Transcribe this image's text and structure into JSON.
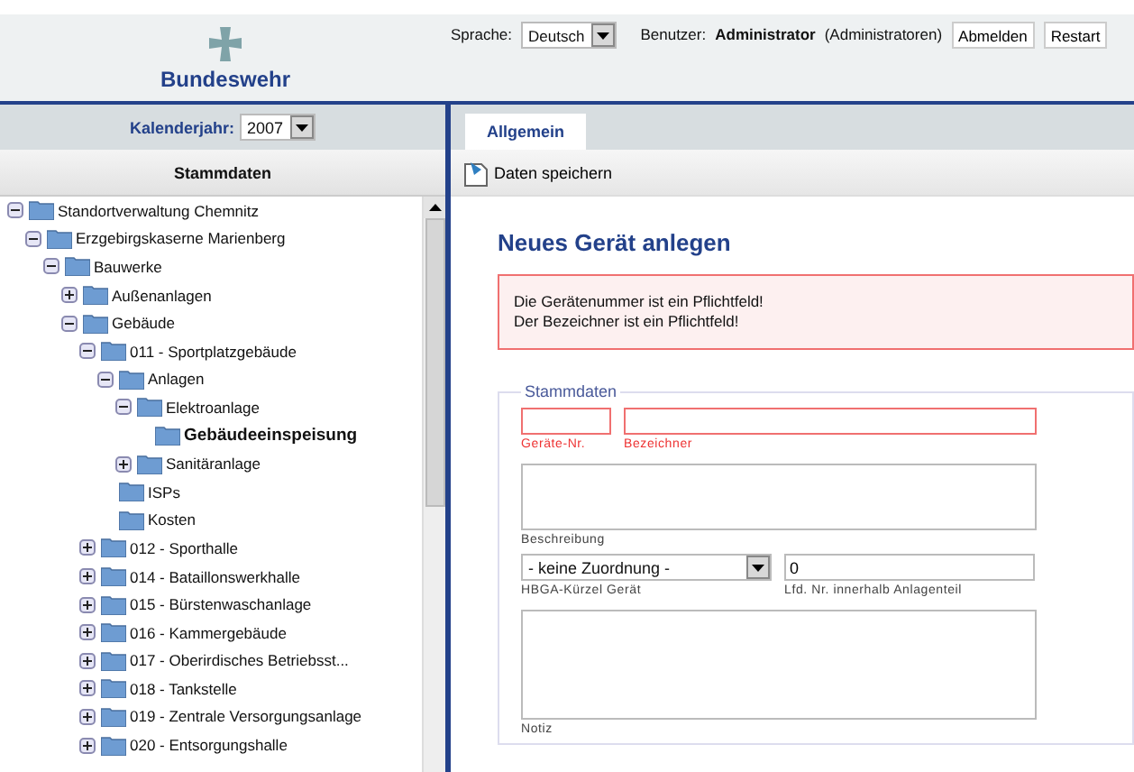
{
  "header": {
    "logo_text": "Bundeswehr",
    "language_label": "Sprache:",
    "language_value": "Deutsch",
    "user_label": "Benutzer:",
    "user_name": "Administrator",
    "user_role": "(Administratoren)",
    "buttons": [
      "Abmelden",
      "Restart"
    ]
  },
  "sidebar": {
    "year_label": "Kalenderjahr:",
    "year_value": "2007",
    "heading": "Stammdaten",
    "tree": [
      {
        "label": "Standortverwaltung Chemnitz",
        "expanded": true,
        "selected": false,
        "children": [
          {
            "label": "Erzgebirgskaserne Marienberg",
            "expanded": true,
            "selected": false,
            "children": [
              {
                "label": "Bauwerke",
                "expanded": true,
                "selected": false,
                "children": [
                  {
                    "label": "Außenanlagen",
                    "expanded": false,
                    "selected": false
                  },
                  {
                    "label": "Gebäude",
                    "expanded": true,
                    "selected": false,
                    "children": [
                      {
                        "label": "011 - Sportplatzgebäude",
                        "expanded": true,
                        "selected": false,
                        "children": [
                          {
                            "label": "Anlagen",
                            "expanded": true,
                            "selected": false,
                            "children": [
                              {
                                "label": "Elektroanlage",
                                "expanded": true,
                                "selected": false,
                                "children": [
                                  {
                                    "label": "Gebäudeeinspeisung",
                                    "selected": true
                                  }
                                ]
                              },
                              {
                                "label": "Sanitäranlage",
                                "expanded": false,
                                "selected": false
                              }
                            ]
                          },
                          {
                            "label": "ISPs",
                            "selected": false
                          },
                          {
                            "label": "Kosten",
                            "selected": false
                          }
                        ]
                      },
                      {
                        "label": "012 - Sporthalle",
                        "expanded": false,
                        "selected": false
                      },
                      {
                        "label": "014 - Bataillonswerkhalle",
                        "expanded": false,
                        "selected": false
                      },
                      {
                        "label": "015 - Bürstenwaschanlage",
                        "expanded": false,
                        "selected": false
                      },
                      {
                        "label": "016 - Kammergebäude",
                        "expanded": false,
                        "selected": false
                      },
                      {
                        "label": "017 - Oberirdisches Betriebsst...",
                        "expanded": false,
                        "selected": false
                      },
                      {
                        "label": "018 - Tankstelle",
                        "expanded": false,
                        "selected": false
                      },
                      {
                        "label": "019 - Zentrale Versorgungsanlage",
                        "expanded": false,
                        "selected": false
                      },
                      {
                        "label": "020 - Entsorgungshalle",
                        "expanded": false,
                        "selected": false
                      }
                    ]
                  }
                ]
              }
            ]
          }
        ]
      }
    ]
  },
  "tabs": [
    {
      "label": "Allgemein",
      "selected": true
    }
  ],
  "toolbar": {
    "save_label": "Daten speichern"
  },
  "form": {
    "title": "Neues Gerät anlegen",
    "errors": [
      "Die Gerätenummer ist ein Pflichtfeld!",
      "Der Bezeichner ist ein Pflichtfeld!"
    ],
    "section": "Stammdaten",
    "number": {
      "label": "Geräte-Nr.",
      "invalid": true
    },
    "name": {
      "label": "Bezeichner",
      "invalid": true
    },
    "description": {
      "label": "Beschreibung"
    },
    "code": {
      "label": "HBGA-Kürzel Gerät",
      "value": "- keine Zuordnung -"
    },
    "seq": {
      "label": "Lfd. Nr. innerhalb Anlagenteil",
      "value": "0"
    },
    "note": {
      "label": "Notiz"
    }
  }
}
